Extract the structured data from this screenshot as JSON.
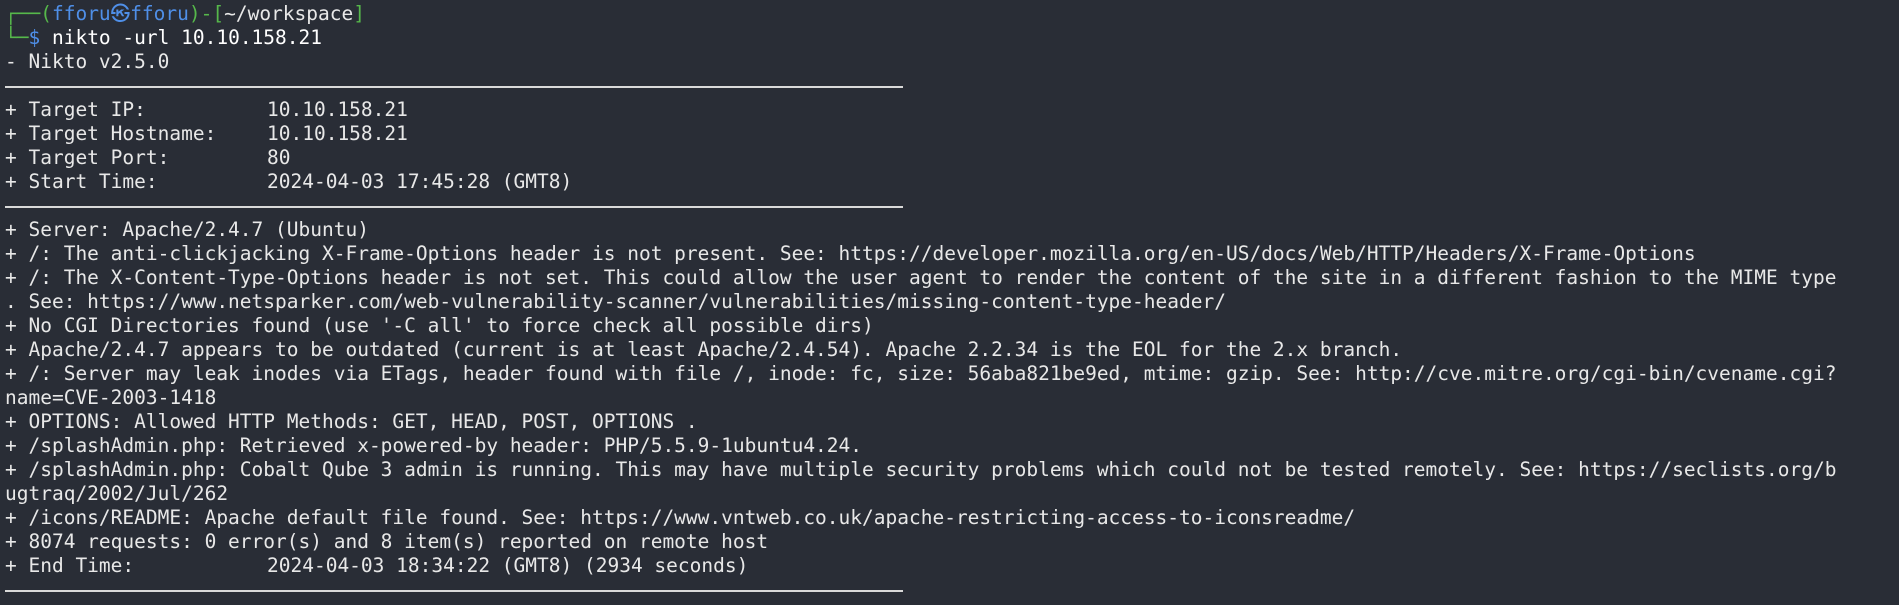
{
  "prompt": {
    "frame_top_left": "┌──(",
    "user_host": "fforu㉿fforu",
    "frame_mid": ")-[",
    "cwd": "~/workspace",
    "frame_end": "]",
    "frame_bottom_left": "└─",
    "dollar": "$",
    "command": " nikto -url 10.10.158.21"
  },
  "banner": "- Nikto v2.5.0",
  "target": {
    "ip_label": "+ Target IP:",
    "ip_value": "10.10.158.21",
    "hostname_label": "+ Target Hostname:",
    "hostname_value": "10.10.158.21",
    "port_label": "+ Target Port:",
    "port_value": "80",
    "start_label": "+ Start Time:",
    "start_value": "2024-04-03 17:45:28 (GMT8)"
  },
  "findings": [
    "+ Server: Apache/2.4.7 (Ubuntu)",
    "+ /: The anti-clickjacking X-Frame-Options header is not present. See: https://developer.mozilla.org/en-US/docs/Web/HTTP/Headers/X-Frame-Options",
    "+ /: The X-Content-Type-Options header is not set. This could allow the user agent to render the content of the site in a different fashion to the MIME type",
    ". See: https://www.netsparker.com/web-vulnerability-scanner/vulnerabilities/missing-content-type-header/",
    "+ No CGI Directories found (use '-C all' to force check all possible dirs)",
    "+ Apache/2.4.7 appears to be outdated (current is at least Apache/2.4.54). Apache 2.2.34 is the EOL for the 2.x branch.",
    "+ /: Server may leak inodes via ETags, header found with file /, inode: fc, size: 56aba821be9ed, mtime: gzip. See: http://cve.mitre.org/cgi-bin/cvename.cgi?",
    "name=CVE-2003-1418",
    "+ OPTIONS: Allowed HTTP Methods: GET, HEAD, POST, OPTIONS .",
    "+ /splashAdmin.php: Retrieved x-powered-by header: PHP/5.5.9-1ubuntu4.24.",
    "+ /splashAdmin.php: Cobalt Qube 3 admin is running. This may have multiple security problems which could not be tested remotely. See: https://seclists.org/b",
    "ugtraq/2002/Jul/262",
    "+ /icons/README: Apache default file found. See: https://www.vntweb.co.uk/apache-restricting-access-to-iconsreadme/",
    "+ 8074 requests: 0 error(s) and 8 item(s) reported on remote host"
  ],
  "end": {
    "label": "+ End Time:",
    "value": "2024-04-03 18:34:22 (GMT8) (2934 seconds)"
  }
}
